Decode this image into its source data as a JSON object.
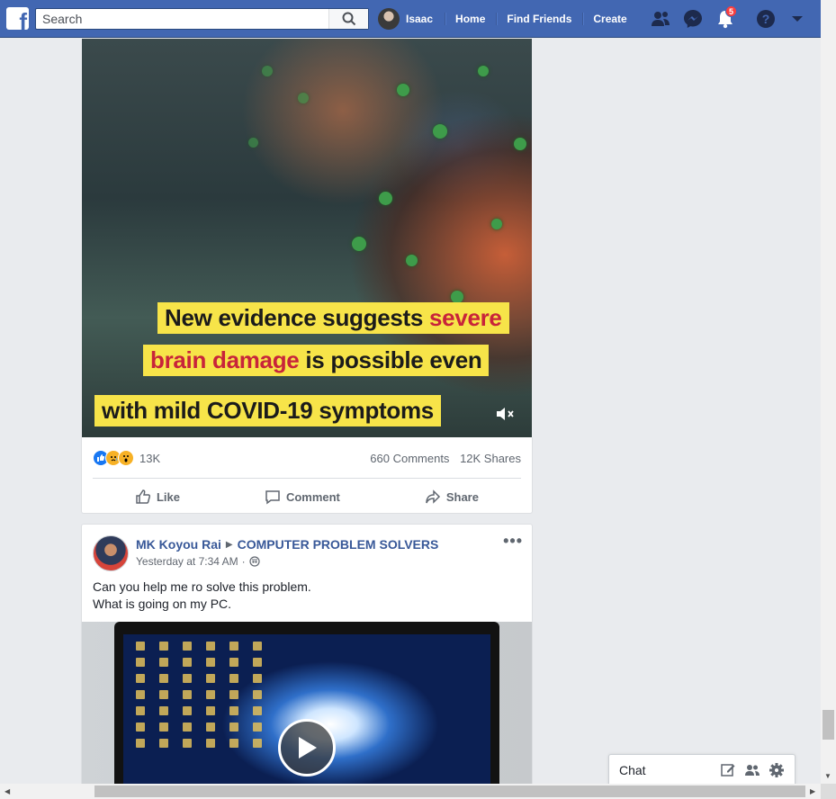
{
  "topbar": {
    "logo_letter": "f",
    "search_placeholder": "Search",
    "user_name": "Isaac",
    "nav_links": [
      "Home",
      "Find Friends",
      "Create"
    ],
    "notifications_count": "5",
    "icons": [
      "friends-icon",
      "messenger-icon",
      "notifications-icon",
      "help-icon",
      "account-menu-icon"
    ]
  },
  "post1": {
    "caption_lines": [
      {
        "pre": "New evidence suggests ",
        "highlight": "severe",
        "post": ""
      },
      {
        "pre": "",
        "highlight": "brain damage",
        "post": " is possible even"
      },
      {
        "pre": "with mild COVID-19 symptoms",
        "highlight": "",
        "post": ""
      }
    ],
    "reaction_count": "13K",
    "comments": "660 Comments",
    "shares": "12K Shares",
    "actions": {
      "like": "Like",
      "comment": "Comment",
      "share": "Share"
    }
  },
  "post2": {
    "author": "MK Koyou Rai",
    "group": "COMPUTER PROBLEM SOLVERS",
    "timestamp": "Yesterday at 7:34 AM",
    "separator": "·",
    "more": "•••",
    "text_line1": "Can you help me ro solve this problem.",
    "text_line2": "What is going on my PC."
  },
  "chat": {
    "label": "Chat"
  }
}
